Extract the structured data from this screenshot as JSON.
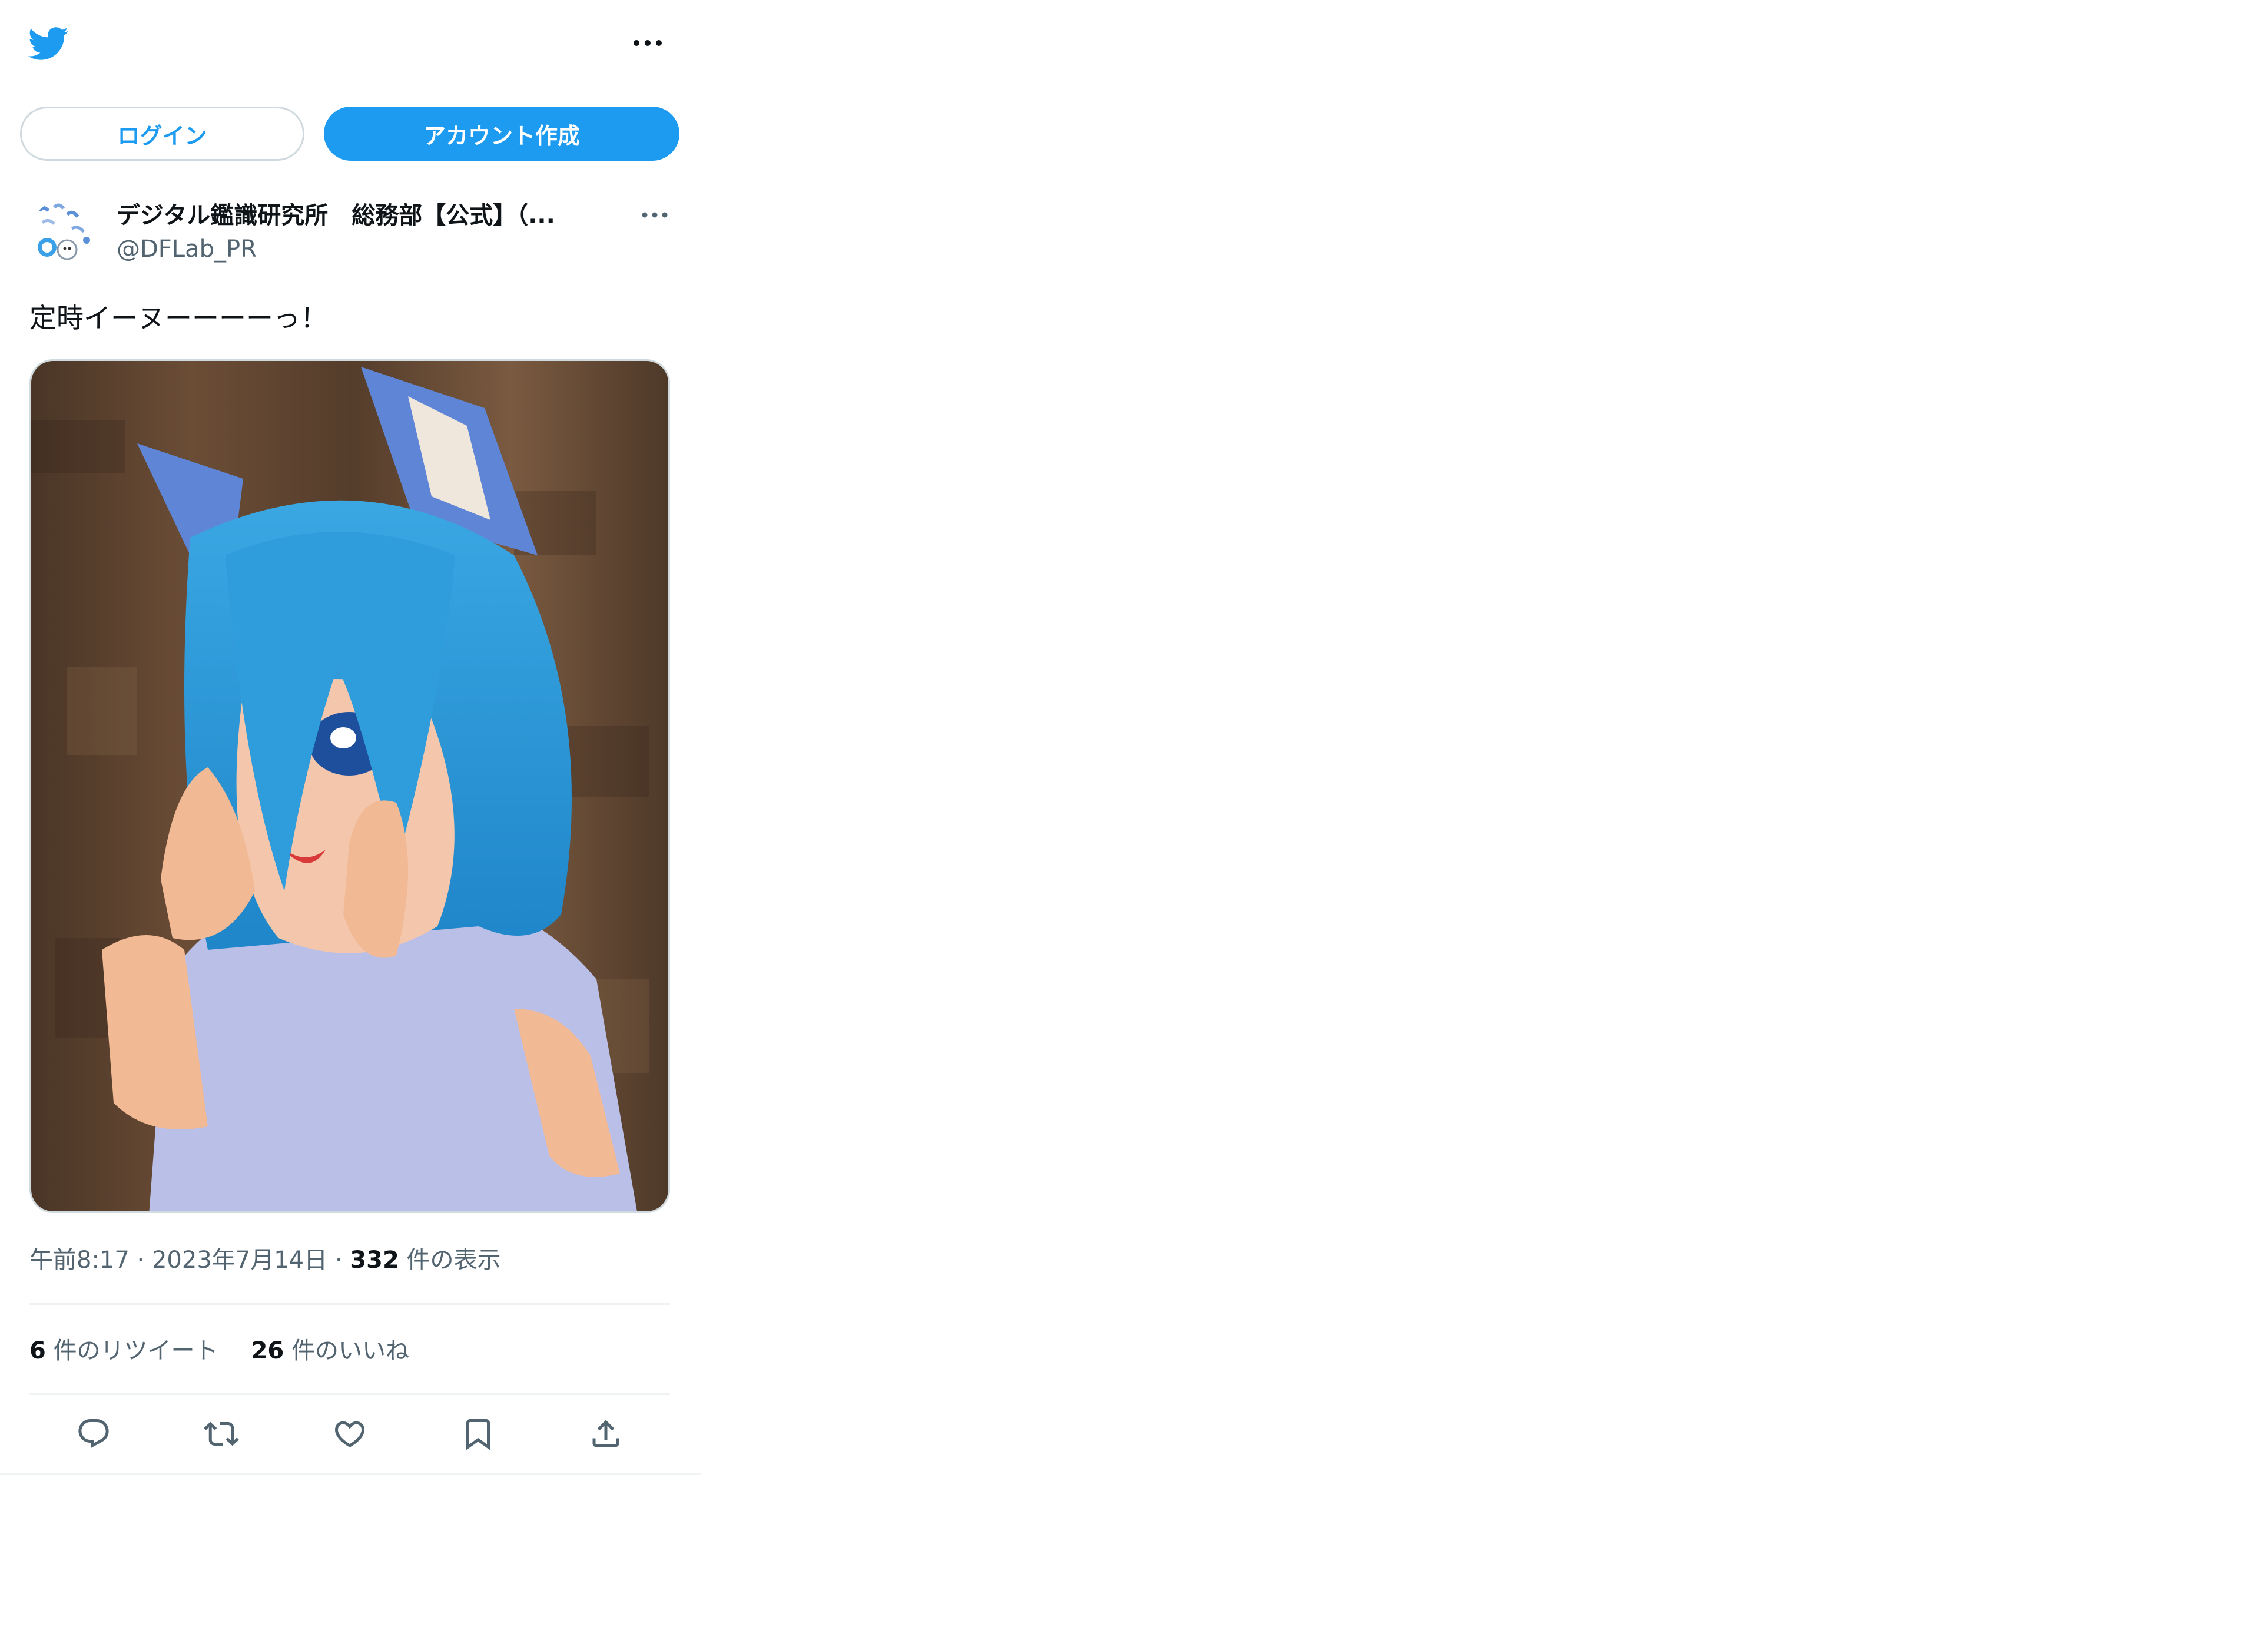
{
  "colors": {
    "brand": "#1d9bf0",
    "text_primary": "#0f1419",
    "text_secondary": "#536471",
    "border": "#cfd9de",
    "divider": "#eff3f4"
  },
  "header": {
    "logo_icon": "twitter-bird-icon",
    "more_icon": "more-horizontal-icon"
  },
  "auth": {
    "login_label": "ログイン",
    "signup_label": "アカウント作成"
  },
  "tweet": {
    "author": {
      "display_name": "デジタル鑑識研究所　総務部【公式】（...",
      "handle": "@DFLab_PR",
      "avatar_icon": "avatar-image"
    },
    "more_icon": "more-horizontal-icon",
    "text": "定時イーヌーーーーっ！",
    "media_icon": "photo-image",
    "meta": {
      "time": "午前8:17",
      "separator1": " · ",
      "date": "2023年7月14日",
      "separator2": " · ",
      "views_count": "332",
      "views_label": " 件の表示"
    },
    "stats": {
      "retweets_count": "6",
      "retweets_label": " 件のリツイート",
      "likes_count": "26",
      "likes_label": " 件のいいね"
    },
    "actions": [
      {
        "icon": "reply-icon"
      },
      {
        "icon": "retweet-icon"
      },
      {
        "icon": "like-heart-icon"
      },
      {
        "icon": "bookmark-icon"
      },
      {
        "icon": "share-icon"
      }
    ]
  }
}
